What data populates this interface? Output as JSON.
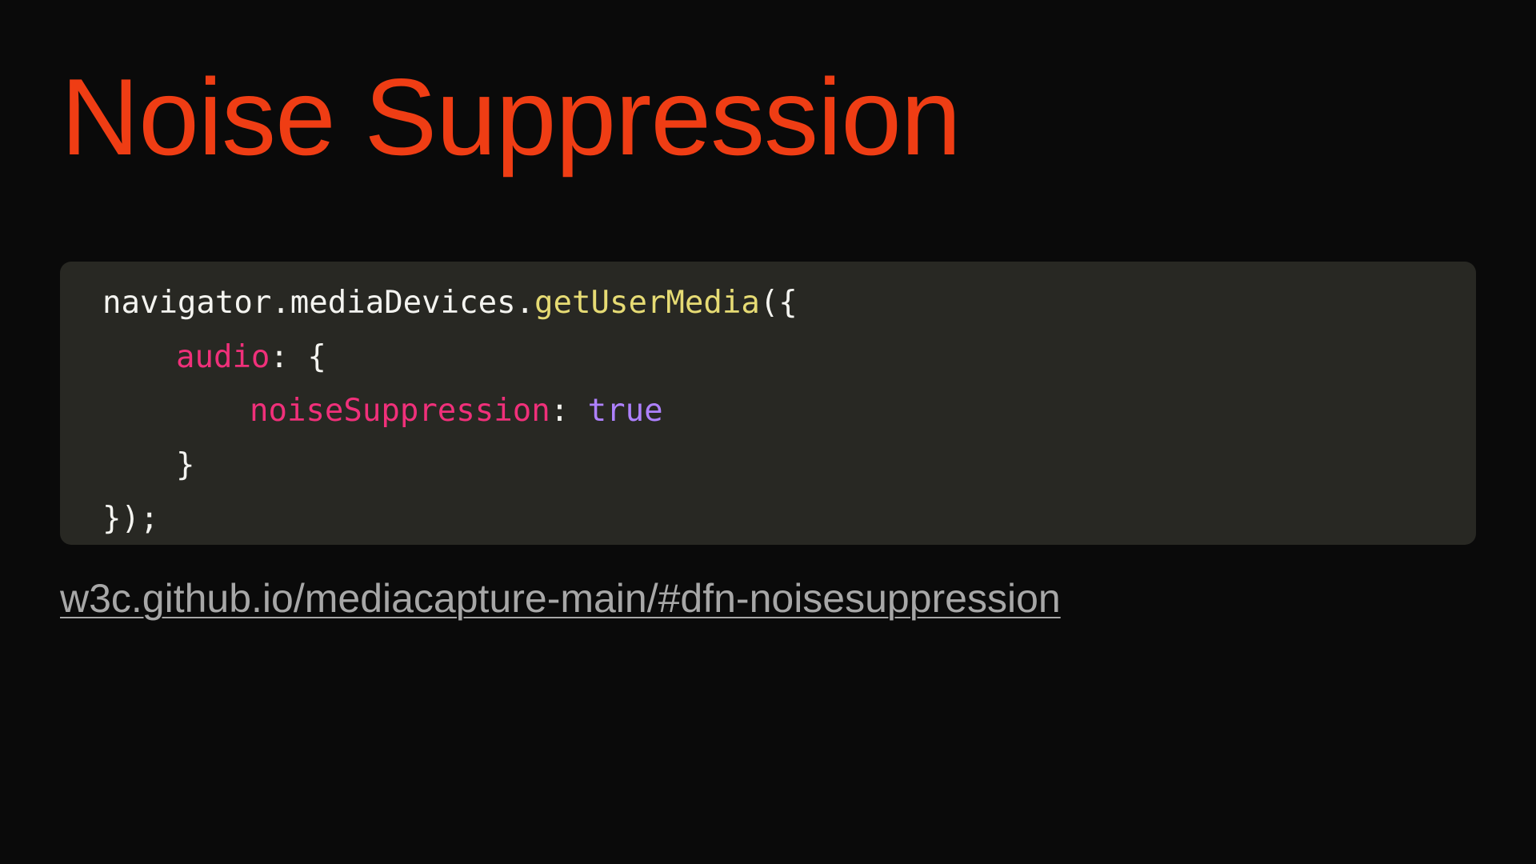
{
  "slide": {
    "title": "Noise Suppression",
    "link_text": "w3c.github.io/mediacapture-main/#dfn-noisesuppression"
  },
  "code": {
    "line1": {
      "object": "navigator.mediaDevices.",
      "method": "getUserMedia",
      "open": "({"
    },
    "line2": {
      "key": "audio",
      "rest": ": {"
    },
    "line3": {
      "key": "noiseSuppression",
      "sep": ": ",
      "value": "true"
    },
    "line4": {
      "text": "}"
    },
    "line5": {
      "text": "});"
    }
  },
  "colors": {
    "title": "#ef3d14",
    "background": "#0a0a0a",
    "code_background": "#282823",
    "method": "#e6db74",
    "key": "#f0307a",
    "boolean": "#ae81ff",
    "link": "#a7a7a7"
  }
}
